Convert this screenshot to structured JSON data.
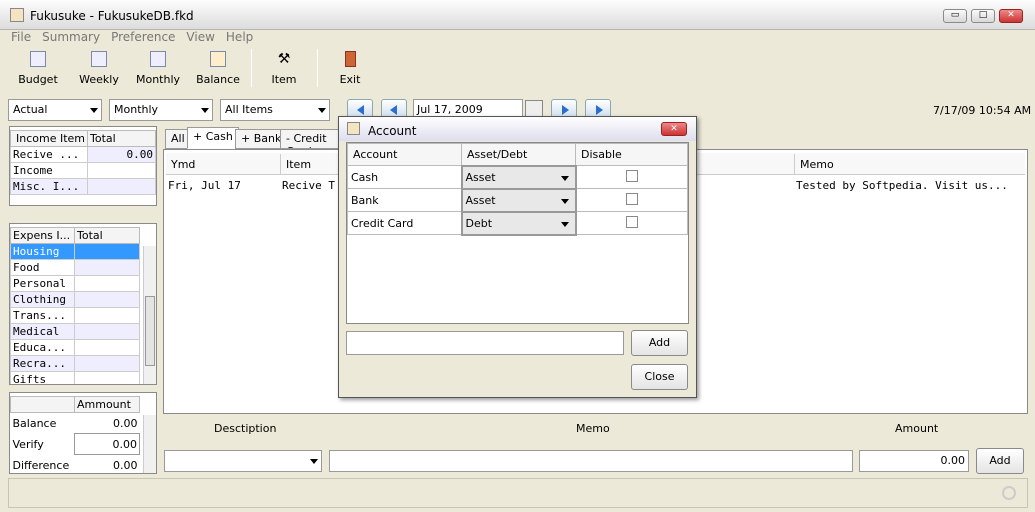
{
  "window": {
    "title": "Fukusuke - FukusukeDB.fkd",
    "min": "▭",
    "max": "□",
    "close": "✕"
  },
  "menu": [
    "File",
    "Summary",
    "Preference",
    "View",
    "Help"
  ],
  "toolbar": {
    "budget": "Budget",
    "weekly": "Weekly",
    "monthly": "Monthly",
    "balance": "Balance",
    "item": "Item",
    "exit": "Exit"
  },
  "filters": {
    "mode": "Actual",
    "period": "Monthly",
    "items": "All Items",
    "date": "Jul 17, 2009"
  },
  "datetime": "7/17/09 10:54 AM",
  "income": {
    "headers": [
      "Income Item",
      "Total"
    ],
    "rows": [
      [
        "Recive ...",
        "0.00"
      ],
      [
        "Income",
        ""
      ],
      [
        "Misc. I...",
        ""
      ]
    ]
  },
  "expense": {
    "headers": [
      "Expens I...",
      "Total"
    ],
    "rows": [
      "Housing",
      "Food",
      "Personal",
      "Clothing",
      "Trans...",
      "Medical",
      "Educa...",
      "Recra...",
      "Gifts"
    ]
  },
  "balance": {
    "header": "Ammount",
    "rows": [
      [
        "Balance",
        "0.00"
      ],
      [
        "Verify",
        "0.00"
      ],
      [
        "Difference",
        "0.00"
      ]
    ]
  },
  "tabs": [
    "All",
    "+ Cash",
    "+ Bank",
    "- Credit Card"
  ],
  "ledger": {
    "headers": [
      "Ymd",
      "Item",
      "Memo"
    ],
    "row": {
      "ymd": "Fri, Jul 17",
      "item": "Recive T",
      "memo": "Tested by Softpedia. Visit us..."
    }
  },
  "entry": {
    "desc_label": "Desctiption",
    "memo_label": "Memo",
    "amount_label": "Amount",
    "amount": "0.00",
    "add": "Add"
  },
  "dialog": {
    "title": "Account",
    "headers": [
      "Account",
      "Asset/Debt",
      "Disable"
    ],
    "rows": [
      {
        "account": "Cash",
        "type": "Asset"
      },
      {
        "account": "Bank",
        "type": "Asset"
      },
      {
        "account": "Credit Card",
        "type": "Debt"
      }
    ],
    "add": "Add",
    "close": "Close",
    "new_account": ""
  }
}
